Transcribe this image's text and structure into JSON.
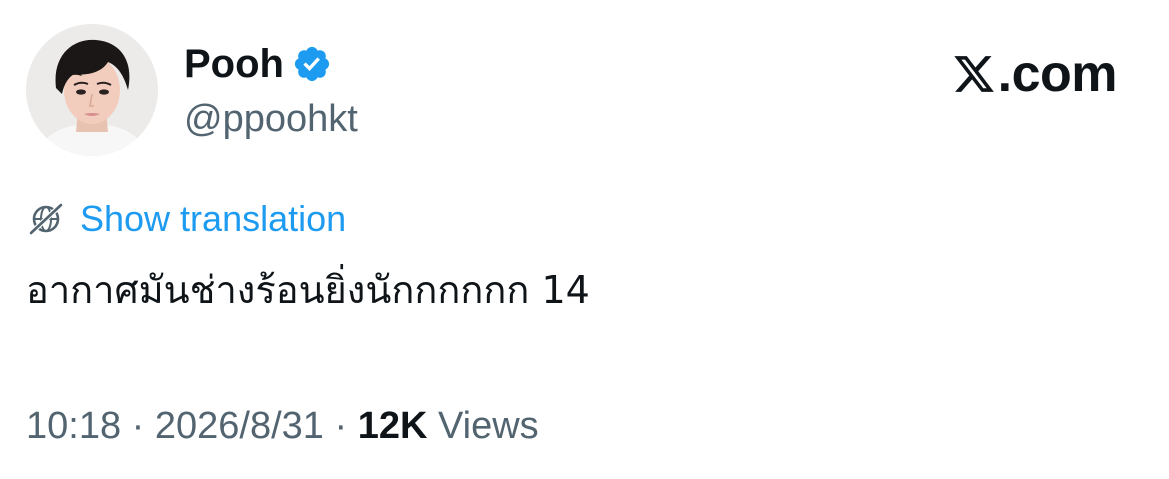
{
  "author": {
    "display_name": "Pooh",
    "handle": "@ppoohkt",
    "verified": true,
    "verified_color": "#1d9bf0"
  },
  "brand": {
    "logo_icon": "x-logo-icon",
    "suffix": ".com"
  },
  "translation": {
    "icon": "globe-slash-icon",
    "label": "Show translation",
    "color": "#1d9bf0"
  },
  "tweet": {
    "text": "อากาศมันช่างร้อนยิ่งนักกกกกก 14"
  },
  "meta": {
    "time": "10:18",
    "separator": " · ",
    "date": "2026/8/31",
    "views_count": "12K",
    "views_label": " Views"
  },
  "colors": {
    "text_primary": "#0f1419",
    "text_secondary": "#536471",
    "accent": "#1d9bf0"
  }
}
